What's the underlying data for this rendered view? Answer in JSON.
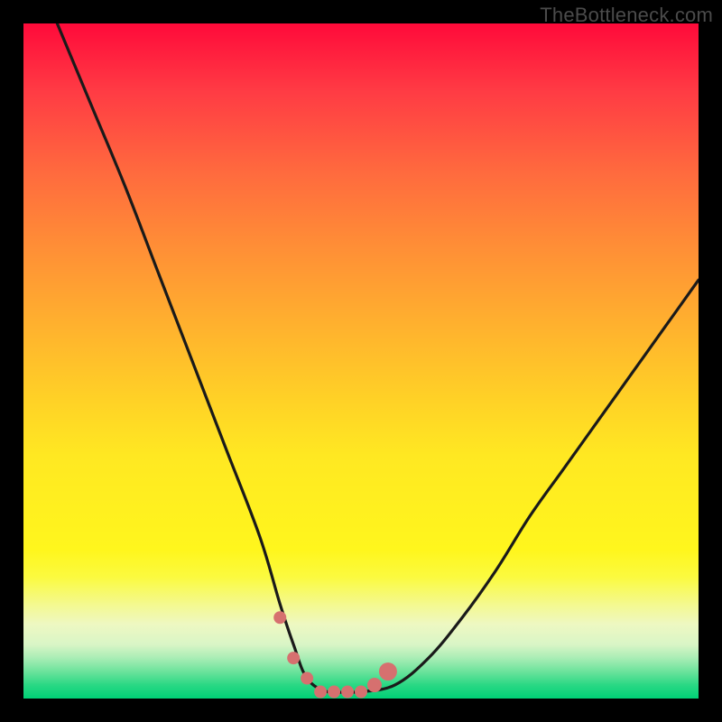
{
  "watermark": {
    "text": "TheBottleneck.com"
  },
  "colors": {
    "frame": "#000000",
    "curve_stroke": "#1a1a1a",
    "marker_fill": "#d6706f",
    "grad_top": "#ff0a3a",
    "grad_bottom": "#00d176"
  },
  "chart_data": {
    "type": "line",
    "title": "",
    "xlabel": "",
    "ylabel": "",
    "xlim": [
      0,
      100
    ],
    "ylim": [
      0,
      100
    ],
    "grid": false,
    "note": "Axes are unlabeled; values are normalized percentages read from the image.",
    "series": [
      {
        "name": "bottleneck-curve",
        "x": [
          5,
          10,
          15,
          20,
          25,
          30,
          35,
          38,
          40,
          42,
          45,
          48,
          50,
          55,
          60,
          65,
          70,
          75,
          80,
          85,
          90,
          95,
          100
        ],
        "y": [
          100,
          88,
          76,
          63,
          50,
          37,
          24,
          14,
          8,
          3,
          1,
          1,
          1,
          2,
          6,
          12,
          19,
          27,
          34,
          41,
          48,
          55,
          62
        ]
      }
    ],
    "markers": {
      "name": "flat-bottom-highlight",
      "x": [
        38,
        40,
        42,
        44,
        46,
        48,
        50,
        52,
        54
      ],
      "y": [
        12,
        6,
        3,
        1,
        1,
        1,
        1,
        2,
        4
      ],
      "size": [
        7,
        7,
        7,
        7,
        7,
        7,
        7,
        8,
        10
      ]
    }
  }
}
